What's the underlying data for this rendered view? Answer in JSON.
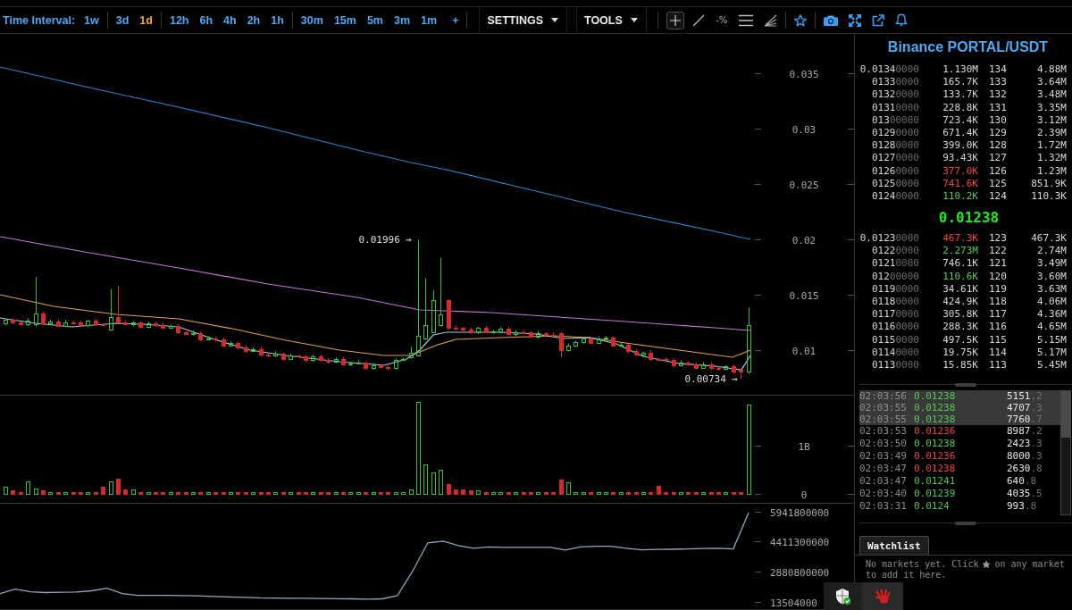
{
  "toolbar": {
    "interval_label": "Time Interval:",
    "interval_groups": [
      [
        {
          "label": "1w",
          "selected": false
        }
      ],
      [
        {
          "label": "3d",
          "selected": false
        },
        {
          "label": "1d",
          "selected": true
        }
      ],
      [
        {
          "label": "12h",
          "selected": false
        },
        {
          "label": "6h",
          "selected": false
        },
        {
          "label": "4h",
          "selected": false
        },
        {
          "label": "2h",
          "selected": false
        },
        {
          "label": "1h",
          "selected": false
        }
      ],
      [
        {
          "label": "30m",
          "selected": false
        },
        {
          "label": "15m",
          "selected": false
        },
        {
          "label": "5m",
          "selected": false
        },
        {
          "label": "3m",
          "selected": false
        },
        {
          "label": "1m",
          "selected": false
        }
      ]
    ],
    "add_button": "+",
    "menus": [
      {
        "label": "SETTINGS"
      },
      {
        "label": "TOOLS"
      }
    ],
    "drawing_tools": [
      {
        "kind": "crosshair",
        "selected": true
      },
      {
        "kind": "line",
        "selected": false
      },
      {
        "kind": "percent",
        "label": "-%",
        "selected": false
      },
      {
        "kind": "horizontal_lines",
        "selected": false
      },
      {
        "kind": "fan",
        "selected": false
      }
    ],
    "favorite_tools": [
      {
        "kind": "star"
      }
    ],
    "action_tools": [
      {
        "kind": "camera"
      },
      {
        "kind": "expand"
      },
      {
        "kind": "external_link"
      },
      {
        "kind": "bell"
      }
    ]
  },
  "chart": {
    "price_axis": [
      "0.035",
      "0.03",
      "0.025",
      "0.02",
      "0.015",
      "0.01"
    ],
    "high_label": "0.01996 →",
    "low_label": "0.00734 →",
    "volume_axis": [
      "1B",
      "0"
    ],
    "indicator": {
      "chart_data": {
        "type": "line",
        "categories": [
          null,
          null,
          null,
          null,
          null,
          null,
          null,
          null,
          null,
          null,
          null,
          null,
          null,
          null,
          null,
          null,
          null,
          null,
          null,
          null,
          null,
          null,
          null,
          null,
          null,
          null,
          null,
          null,
          null,
          null,
          null,
          null,
          null,
          null,
          null,
          null,
          null,
          null,
          null,
          null,
          null,
          null,
          null,
          null,
          null,
          null,
          null,
          null,
          null,
          null
        ],
        "ylim": [
          931300000,
          5941800000
        ],
        "yticks": [
          {
            "value": 5941800000,
            "label": "5941800000"
          },
          {
            "value": 4411300000,
            "label": "4411300000"
          },
          {
            "value": 2880800000,
            "label": "2880800000"
          }
        ],
        "series": [
          {
            "color": "#8eaabd",
            "values": [
              1750000000,
              1980000000,
              1840000000,
              1800000000,
              1820000000,
              1830000000,
              1890000000,
              2020000000,
              1750000000,
              1660000000,
              1660000000,
              1660000000,
              1650000000,
              1630000000,
              1600000000,
              1580000000,
              1560000000,
              1530000000,
              1520000000,
              1510000000,
              1510000000,
              1500000000,
              1490000000,
              1480000000,
              1460000000,
              1480000000,
              1640000000,
              2890000000,
              4350000000,
              4440000000,
              4210000000,
              4070000000,
              4140000000,
              4120000000,
              4120000000,
              4120000000,
              4120000000,
              3980000000,
              4140000000,
              4170000000,
              4170000000,
              4070000000,
              3990000000,
              4010000000,
              4020000000,
              4040000000,
              4060000000,
              4070000000,
              4040000000,
              5900000000
            ]
          }
        ]
      },
      "cut_tick_label": "13504000"
    }
  },
  "order_book": {
    "title": "Binance PORTAL/USDT",
    "asks": [
      {
        "price": "0.01340000",
        "size": "1.130M",
        "count": "134",
        "total": "4.88M",
        "color": "#d6d6d6"
      },
      {
        "price": "01330000",
        "size": "165.7K",
        "count": "133",
        "total": "3.64M",
        "color": "#d6d6d6"
      },
      {
        "price": "01320000",
        "size": "133.7K",
        "count": "132",
        "total": "3.48M",
        "color": "#d6d6d6"
      },
      {
        "price": "01310000",
        "size": "228.8K",
        "count": "131",
        "total": "3.35M",
        "color": "#d6d6d6"
      },
      {
        "price": "01300000",
        "size": "723.4K",
        "count": "130",
        "total": "3.12M",
        "color": "#d6d6d6"
      },
      {
        "price": "01290000",
        "size": "671.4K",
        "count": "129",
        "total": "2.39M",
        "color": "#d6d6d6"
      },
      {
        "price": "01280000",
        "size": "399.0K",
        "count": "128",
        "total": "1.72M",
        "color": "#d6d6d6"
      },
      {
        "price": "01270000",
        "size": "93.43K",
        "count": "127",
        "total": "1.32M",
        "color": "#d6d6d6"
      },
      {
        "price": "01260000",
        "size": "377.0K",
        "count": "126",
        "total": "1.23M",
        "color": "#f04a4a"
      },
      {
        "price": "01250000",
        "size": "741.6K",
        "count": "125",
        "total": "851.9K",
        "color": "#f04a4a"
      },
      {
        "price": "01240000",
        "size": "110.2K",
        "count": "124",
        "total": "110.3K",
        "color": "#5cc85c"
      }
    ],
    "last_price": "0.01238",
    "bids": [
      {
        "price": "0.01230000",
        "size": "467.3K",
        "count": "123",
        "total": "467.3K",
        "color": "#f04a4a"
      },
      {
        "price": "01220000",
        "size": "2.273M",
        "count": "122",
        "total": "2.74M",
        "color": "#5cc85c"
      },
      {
        "price": "01210000",
        "size": "746.1K",
        "count": "121",
        "total": "3.49M",
        "color": "#d6d6d6"
      },
      {
        "price": "01200000",
        "size": "110.6K",
        "count": "120",
        "total": "3.60M",
        "color": "#5cc85c"
      },
      {
        "price": "01190000",
        "size": "34.61K",
        "count": "119",
        "total": "3.63M",
        "color": "#d6d6d6"
      },
      {
        "price": "01180000",
        "size": "424.9K",
        "count": "118",
        "total": "4.06M",
        "color": "#d6d6d6"
      },
      {
        "price": "01170000",
        "size": "305.8K",
        "count": "117",
        "total": "4.36M",
        "color": "#d6d6d6"
      },
      {
        "price": "01160000",
        "size": "288.3K",
        "count": "116",
        "total": "4.65M",
        "color": "#d6d6d6"
      },
      {
        "price": "01150000",
        "size": "497.5K",
        "count": "115",
        "total": "5.15M",
        "color": "#d6d6d6"
      },
      {
        "price": "01140000",
        "size": "19.75K",
        "count": "114",
        "total": "5.17M",
        "color": "#d6d6d6"
      },
      {
        "price": "01130000",
        "size": "15.85K",
        "count": "113",
        "total": "5.45M",
        "color": "#d6d6d6"
      }
    ]
  },
  "trades": [
    {
      "time": "02:03:56",
      "price": "0.01238",
      "amount": "5151.2",
      "color": "#55c855",
      "highlighted": true
    },
    {
      "time": "02:03:55",
      "price": "0.01238",
      "amount": "4707.3",
      "color": "#55c855",
      "highlighted": true
    },
    {
      "time": "02:03:55",
      "price": "0.01238",
      "amount": "7760.7",
      "color": "#55c855",
      "highlighted": true
    },
    {
      "time": "02:03:53",
      "price": "0.01236",
      "amount": "8987.2",
      "color": "#e84848",
      "highlighted": false
    },
    {
      "time": "02:03:50",
      "price": "0.01238",
      "amount": "2423.3",
      "color": "#55c855",
      "highlighted": false
    },
    {
      "time": "02:03:49",
      "price": "0.01236",
      "amount": "8000.3",
      "color": "#e84848",
      "highlighted": false
    },
    {
      "time": "02:03:47",
      "price": "0.01238",
      "amount": "2630.8",
      "color": "#e84848",
      "highlighted": false
    },
    {
      "time": "02:03:47",
      "price": "0.01241",
      "amount": "640.8",
      "color": "#55c855",
      "highlighted": false
    },
    {
      "time": "02:03:40",
      "price": "0.01239",
      "amount": "4035.5",
      "color": "#55c855",
      "highlighted": false
    },
    {
      "time": "02:03:31",
      "price": "0.0124",
      "amount": "993.8",
      "color": "#55c855",
      "highlighted": false
    }
  ],
  "watchlist": {
    "tabs": [
      {
        "label": "Watchlist",
        "selected": true
      }
    ],
    "message_start": "No markets yet. Click",
    "message_end": "on any market",
    "message_second_line": "to add it here."
  }
}
